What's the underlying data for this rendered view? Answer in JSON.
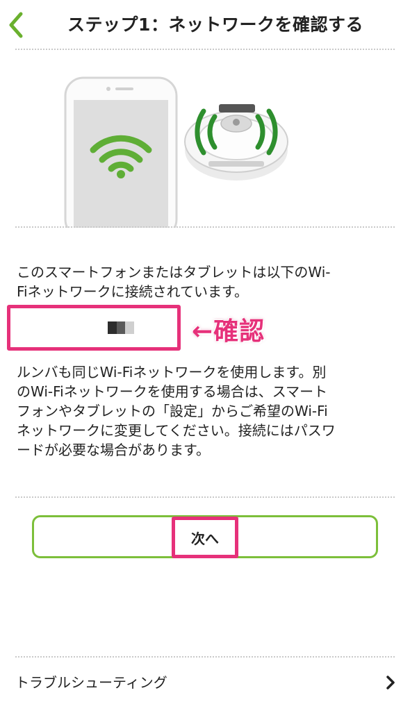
{
  "header": {
    "title": "ステップ1：ネットワークを確認する",
    "back_icon": "chevron-left-icon",
    "accent_color": "#6ab02e"
  },
  "illustration": {
    "phone_icon": "smartphone-wifi-icon",
    "robot_icon": "roomba-wifi-icon",
    "wifi_color": "#5fae36"
  },
  "main": {
    "intro_line1": "このスマートフォンまたはタブレットは以下のWi-",
    "intro_line2": "Fiネットワークに接続されています。",
    "ssid_value": "",
    "annotation": "←確認",
    "annotation_color": "#e6317a",
    "info_lines": [
      "ルンバも同じWi-Fiネットワークを使用します。別",
      "のWi-Fiネットワークを使用する場合は、スマート",
      "フォンやタブレットの「設定」からご希望のWi-Fi",
      "ネットワークに変更してください。接続にはパスワ",
      "ードが必要な場合があります。"
    ]
  },
  "actions": {
    "next_label": "次へ",
    "button_border_color": "#7cbf3a"
  },
  "footer": {
    "troubleshooting_label": "トラブルシューティング",
    "chevron_icon": "chevron-right-icon"
  }
}
